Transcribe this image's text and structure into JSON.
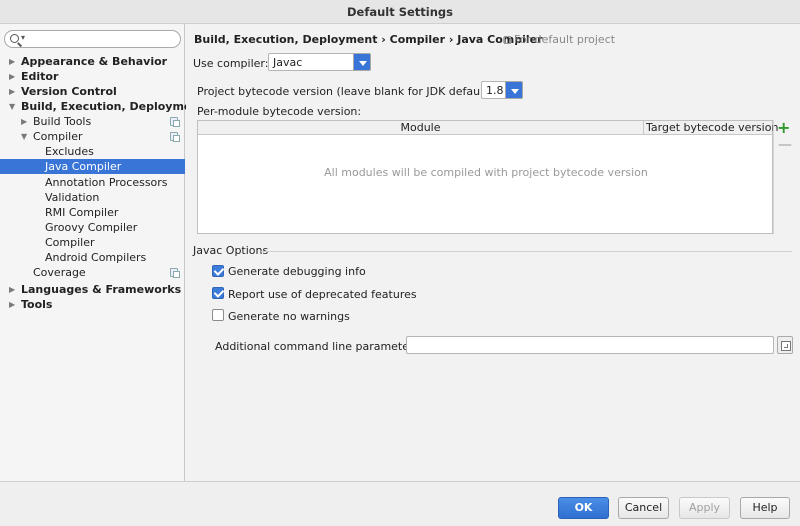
{
  "window": {
    "title": "Default Settings"
  },
  "search": {
    "placeholder": "",
    "dropdown_glyph": "▾"
  },
  "sidebar": {
    "items": [
      {
        "label": "Appearance & Behavior",
        "arrow": "▶"
      },
      {
        "label": "Editor",
        "arrow": "▶"
      },
      {
        "label": "Version Control",
        "arrow": "▶"
      },
      {
        "label": "Build, Execution, Deployment",
        "arrow": "▼"
      },
      {
        "label": "Build Tools",
        "arrow": "▶"
      },
      {
        "label": "Compiler",
        "arrow": "▼"
      },
      {
        "label": "Excludes"
      },
      {
        "label": "Java Compiler"
      },
      {
        "label": "Annotation Processors"
      },
      {
        "label": "Validation"
      },
      {
        "label": "RMI Compiler"
      },
      {
        "label": "Groovy Compiler"
      },
      {
        "label": "Compiler"
      },
      {
        "label": "Android Compilers"
      },
      {
        "label": "Coverage"
      },
      {
        "label": "Languages & Frameworks",
        "arrow": "▶"
      },
      {
        "label": "Tools",
        "arrow": "▶"
      }
    ]
  },
  "main": {
    "breadcrumb": "Build, Execution, Deployment › Compiler › Java Compiler",
    "for_default": "For default project",
    "use_compiler_label": "Use compiler:",
    "use_compiler_value": "Javac",
    "bytecode_label": "Project bytecode version (leave blank for JDK default):",
    "bytecode_value": "1.8",
    "per_module_label": "Per-module bytecode version:",
    "table": {
      "columns": [
        "Module",
        "Target bytecode version"
      ],
      "empty_text": "All modules will be compiled with project bytecode version",
      "add_glyph": "+",
      "remove_glyph": "—"
    },
    "javac_options": {
      "title": "Javac Options",
      "checkboxes": [
        {
          "label": "Generate debugging info",
          "checked": true
        },
        {
          "label": "Report use of deprecated features",
          "checked": true
        },
        {
          "label": "Generate no warnings",
          "checked": false
        }
      ],
      "additional_label": "Additional command line parameters:",
      "additional_value": ""
    }
  },
  "footer": {
    "ok": "OK",
    "cancel": "Cancel",
    "apply": "Apply",
    "help": "Help"
  },
  "colors": {
    "selection": "#3875d7",
    "accent": "#3b7bd9",
    "add_green": "#2e9a2e"
  }
}
